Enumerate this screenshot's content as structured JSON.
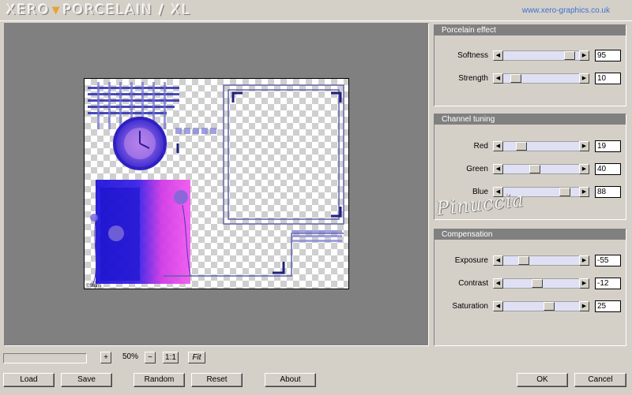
{
  "header": {
    "logo_left": "XERO",
    "logo_right": "PORCELAIN / XL",
    "site": "www.xero-graphics.co.uk"
  },
  "preview": {
    "signature": "©Signs"
  },
  "watermark": "Pinuccia",
  "panels": [
    {
      "title": "Porcelain effect",
      "controls": [
        {
          "label": "Softness",
          "value": "95",
          "level": 95
        },
        {
          "label": "Strength",
          "value": "10",
          "level": 10
        }
      ]
    },
    {
      "title": "Channel tuning",
      "controls": [
        {
          "label": "Red",
          "value": "19",
          "level": 19
        },
        {
          "label": "Green",
          "value": "40",
          "level": 40
        },
        {
          "label": "Blue",
          "value": "88",
          "level": 88
        }
      ]
    },
    {
      "title": "Compensation",
      "controls": [
        {
          "label": "Exposure",
          "value": "-55",
          "level": 22
        },
        {
          "label": "Contrast",
          "value": "-12",
          "level": 44
        },
        {
          "label": "Saturation",
          "value": "25",
          "level": 62
        }
      ]
    }
  ],
  "zoom": {
    "plus": "+",
    "value": "50%",
    "minus": "−",
    "one_to_one": "1:1",
    "fit": "Fit"
  },
  "buttons": {
    "load": "Load",
    "save": "Save",
    "random": "Random",
    "reset": "Reset",
    "about": "About",
    "ok": "OK",
    "cancel": "Cancel"
  },
  "colors": {
    "accent_orange": "#e7a23a",
    "link_blue": "#3f6fd0",
    "panel_title_bg": "#808080",
    "window_bg": "#d4d0c8"
  }
}
